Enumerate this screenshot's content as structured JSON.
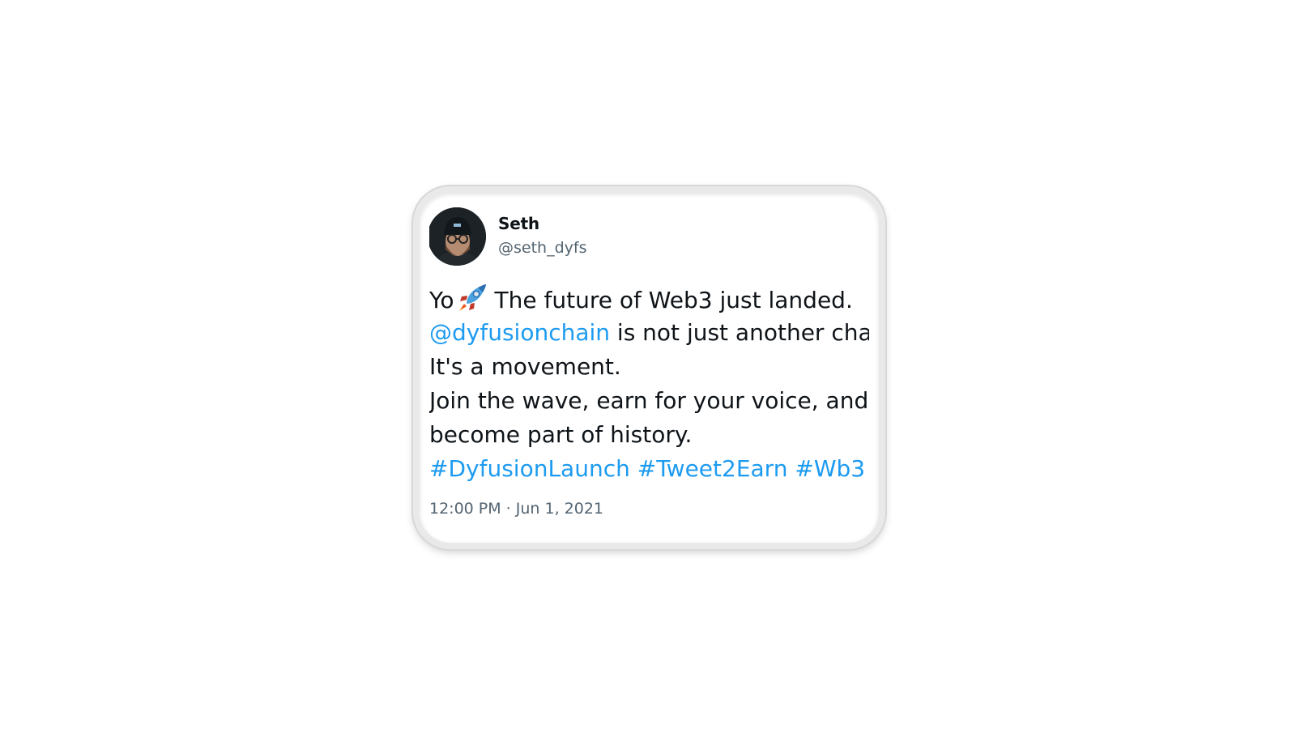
{
  "tweet": {
    "display_name": "Seth",
    "handle": "@seth_dyfs",
    "lines": {
      "l1_before": "Yo",
      "l1_after": "The future of Web3 just landed.",
      "l2_mention": "@dyfusionchain",
      "l2_after": " is not just another cha",
      "l3": "It's a movement.",
      "l4": "Join the wave, earn for your voice, and",
      "l5": "become part of history.",
      "hashtags": [
        "#DyfusionLaunch",
        "#Tweet2Earn",
        "#Wb3"
      ]
    },
    "timestamp": "12:00 PM · Jun 1, 2021",
    "icons": {
      "avatar": "user-avatar",
      "rocket": "rocket-emoji-icon"
    },
    "colors": {
      "link": "#1d9bf0",
      "text": "#0f1419",
      "secondary": "#536471"
    }
  }
}
